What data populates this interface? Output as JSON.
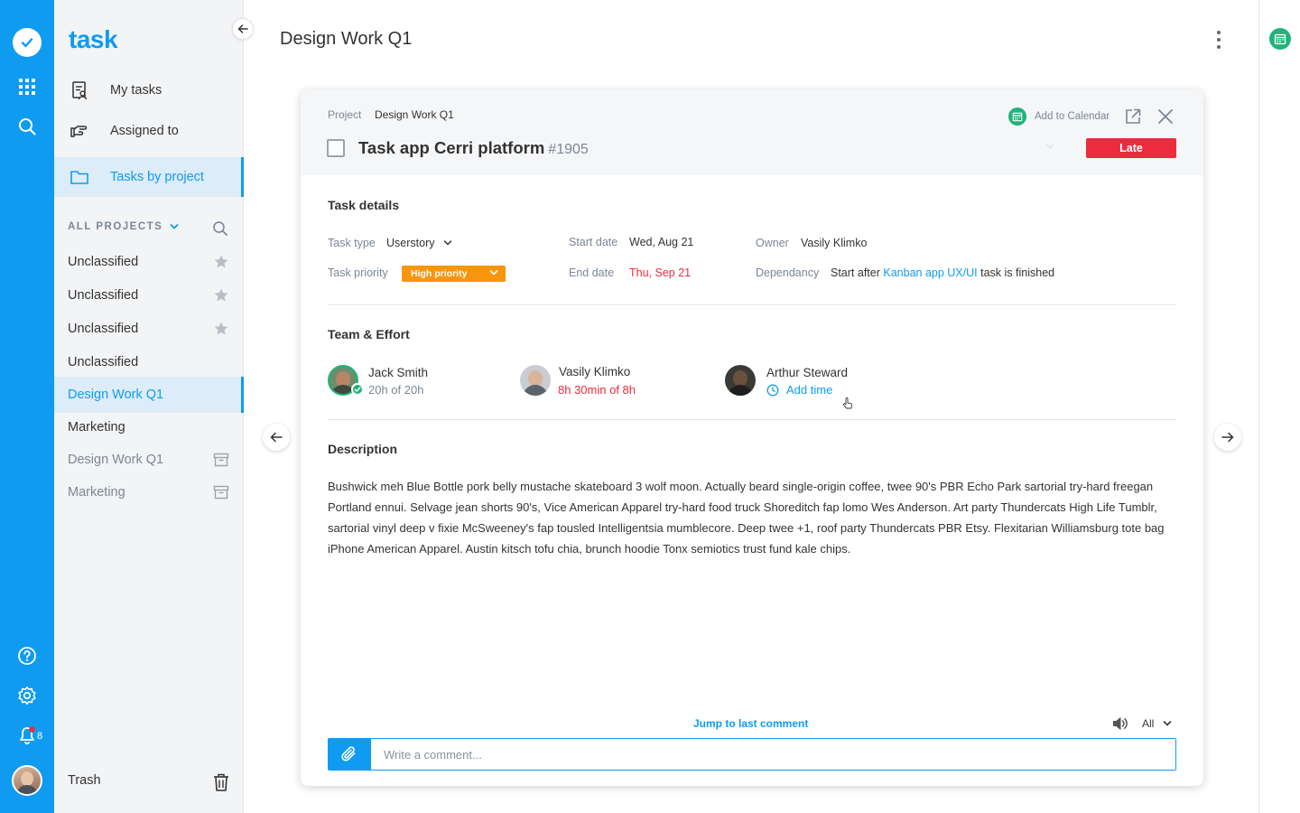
{
  "app": {
    "logo_text": "task"
  },
  "rail": {
    "notification_count": "8"
  },
  "sidebar": {
    "nav": [
      {
        "label": "My tasks"
      },
      {
        "label": "Assigned to"
      },
      {
        "label": "Tasks by project",
        "active": true
      }
    ],
    "projects_header": "ALL PROJECTS",
    "projects": [
      {
        "label": "Unclassified",
        "starred": true
      },
      {
        "label": "Unclassified",
        "starred": true
      },
      {
        "label": "Unclassified",
        "starred": true
      },
      {
        "label": "Unclassified"
      },
      {
        "label": "Design Work Q1",
        "active": true
      },
      {
        "label": "Marketing"
      },
      {
        "label": "Design Work Q1",
        "archived": true
      },
      {
        "label": "Marketing",
        "archived": true
      }
    ],
    "trash_label": "Trash"
  },
  "header": {
    "title": "Design Work Q1"
  },
  "task": {
    "project_label": "Project",
    "project_name": "Design Work Q1",
    "add_to_calendar": "Add to Calendar",
    "title": "Task app Cerri platform",
    "id": "#1905",
    "status": "Late",
    "details": {
      "section_title": "Task details",
      "task_type_label": "Task type",
      "task_type_value": "Userstory",
      "priority_label": "Task priority",
      "priority_value": "High priority",
      "start_label": "Start date",
      "start_value": "Wed, Aug 21",
      "end_label": "End date",
      "end_value": "Thu, Sep 21",
      "owner_label": "Owner",
      "owner_value": "Vasily Klimko",
      "dependency_label": "Dependancy",
      "dependency_prefix": "Start after",
      "dependency_link": "Kanban app UX/UI",
      "dependency_suffix": "task is finished"
    },
    "team": {
      "section_title": "Team & Effort",
      "members": [
        {
          "name": "Jack Smith",
          "effort": "20h of 20h"
        },
        {
          "name": "Vasily Klimko",
          "effort": "8h 30min of 8h"
        },
        {
          "name": "Arthur Steward",
          "effort": "Add time"
        }
      ]
    },
    "description": {
      "section_title": "Description",
      "text": "Bushwick meh Blue Bottle pork belly mustache skateboard 3 wolf moon. Actually beard single-origin coffee, twee 90's PBR Echo Park sartorial try-hard freegan Portland ennui. Selvage jean shorts 90's,  Vice American Apparel try-hard food truck Shoreditch fap lomo Wes Anderson. Art party Thundercats High Life Tumblr, sartorial vinyl deep v fixie McSweeney's fap tousled Intelligentsia mumblecore. Deep  twee +1, roof party Thundercats PBR Etsy. Flexitarian Williamsburg tote bag iPhone American Apparel. Austin kitsch tofu chia, brunch hoodie Tonx semiotics trust fund kale chips."
    },
    "comments": {
      "jump_label": "Jump to last comment",
      "filter_value": "All",
      "placeholder": "Write a comment..."
    }
  },
  "colors": {
    "brand": "#0f9bf0",
    "late": "#ea2c3e",
    "priority_high": "#f7960e",
    "success": "#1fb47a"
  }
}
